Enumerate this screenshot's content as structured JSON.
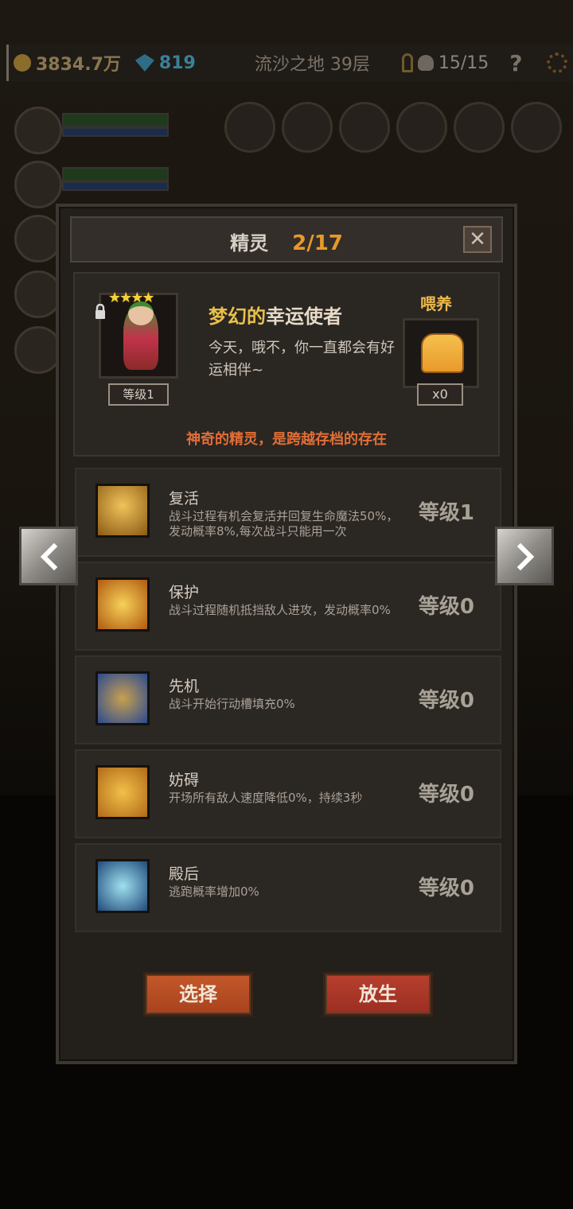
{
  "hud": {
    "gold": "3834.7万",
    "gems": "819",
    "location": "流沙之地 39层",
    "keys_skulls": "15/15",
    "help": "?"
  },
  "modal": {
    "title": "精灵",
    "count": "2/17",
    "close_label": "✕"
  },
  "spirit": {
    "stars": "★★★★",
    "level": "等级1",
    "name_accent": "梦幻的",
    "name_rest": "幸运使者",
    "description": "今天，哦不，你一直都会有好运相伴~",
    "feed_label": "喂养",
    "feed_count": "x0",
    "tagline": "神奇的精灵，是跨越存档的存在"
  },
  "skills": [
    {
      "name": "复活",
      "desc": "战斗过程有机会复活并回复生命魔法50%，发动概率8%,每次战斗只能用一次",
      "level": "等级1",
      "icon": "revive-icon",
      "color": "#d59a2a"
    },
    {
      "name": "保护",
      "desc": "战斗过程随机抵挡敌人进攻，发动概率0%",
      "level": "等级0",
      "icon": "protect-icon",
      "color": "#e08a1e"
    },
    {
      "name": "先机",
      "desc": "战斗开始行动槽填充0%",
      "level": "等级0",
      "icon": "leopard-icon",
      "color": "#3a5ea8"
    },
    {
      "name": "妨碍",
      "desc": "开场所有敌人速度降低0%，持续3秒",
      "level": "等级0",
      "icon": "chain-boot-icon",
      "color": "#d8901e"
    },
    {
      "name": "殿后",
      "desc": "逃跑概率增加0%",
      "level": "等级0",
      "icon": "wings-icon",
      "color": "#2a6aa0"
    }
  ],
  "buttons": {
    "select": "选择",
    "release": "放生"
  }
}
